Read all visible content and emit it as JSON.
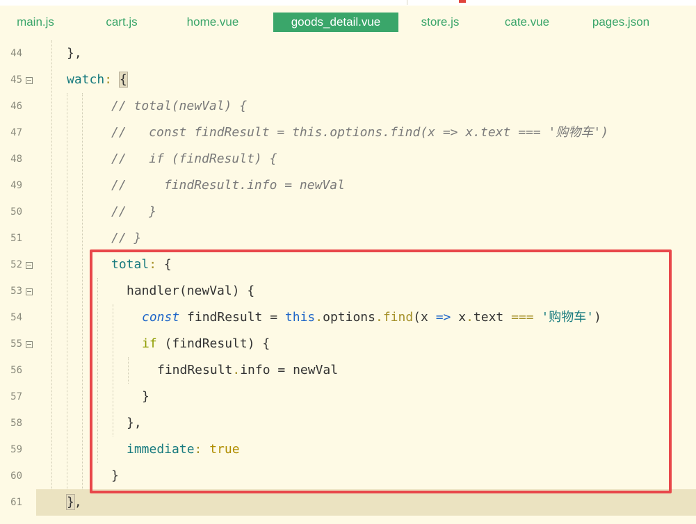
{
  "tabs": [
    {
      "label": "main.js",
      "active": false
    },
    {
      "label": "cart.js",
      "active": false
    },
    {
      "label": "home.vue",
      "active": false
    },
    {
      "label": "goods_detail.vue",
      "active": true
    },
    {
      "label": "store.js",
      "active": false
    },
    {
      "label": "cate.vue",
      "active": false
    },
    {
      "label": "pages.json",
      "active": false
    }
  ],
  "colors": {
    "background": "#fefae5",
    "tab_text": "#3aa56a",
    "active_tab_bg": "#3aa66a",
    "highlight_box": "#e8474a",
    "current_line": "#ebe3c1"
  },
  "editor": {
    "lines": [
      {
        "n": "44",
        "fold": false,
        "tokens": [
          {
            "t": "},",
            "c": ""
          }
        ]
      },
      {
        "n": "45",
        "fold": true,
        "tokens": [
          {
            "t": "watch",
            "c": "key"
          },
          {
            "t": ": ",
            "c": "punc"
          },
          {
            "t": "{",
            "c": "bracehl"
          }
        ]
      },
      {
        "n": "46",
        "fold": false,
        "tokens": [
          {
            "t": "// total(newVal) {",
            "c": "cmt"
          }
        ]
      },
      {
        "n": "47",
        "fold": false,
        "tokens": [
          {
            "t": "//   const findResult = this.options.find(x => x.text === '购物车')",
            "c": "cmt"
          }
        ]
      },
      {
        "n": "48",
        "fold": false,
        "tokens": [
          {
            "t": "//   if (findResult) {",
            "c": "cmt"
          }
        ]
      },
      {
        "n": "49",
        "fold": false,
        "tokens": [
          {
            "t": "//     findResult.info = newVal",
            "c": "cmt"
          }
        ]
      },
      {
        "n": "50",
        "fold": false,
        "tokens": [
          {
            "t": "//   }",
            "c": "cmt"
          }
        ]
      },
      {
        "n": "51",
        "fold": false,
        "tokens": [
          {
            "t": "// }",
            "c": "cmt"
          }
        ]
      },
      {
        "n": "52",
        "fold": true,
        "tokens": [
          {
            "t": "total",
            "c": "key"
          },
          {
            "t": ": ",
            "c": "punc"
          },
          {
            "t": "{",
            "c": ""
          }
        ]
      },
      {
        "n": "53",
        "fold": true,
        "tokens": [
          {
            "t": "handler(newVal) {",
            "c": ""
          }
        ]
      },
      {
        "n": "54",
        "fold": false,
        "tokens": [
          {
            "t": "const",
            "c": "kw"
          },
          {
            "t": " findResult = ",
            "c": ""
          },
          {
            "t": "this",
            "c": "this"
          },
          {
            "t": ".",
            "c": "punc"
          },
          {
            "t": "options",
            "c": ""
          },
          {
            "t": ".",
            "c": "punc"
          },
          {
            "t": "find",
            "c": "fn"
          },
          {
            "t": "(x ",
            "c": ""
          },
          {
            "t": "=>",
            "c": "arrow"
          },
          {
            "t": " x",
            "c": ""
          },
          {
            "t": ".",
            "c": "punc"
          },
          {
            "t": "text ",
            "c": ""
          },
          {
            "t": "===",
            "c": "punc"
          },
          {
            "t": " ",
            "c": ""
          },
          {
            "t": "'购物车'",
            "c": "str"
          },
          {
            "t": ")",
            "c": ""
          }
        ]
      },
      {
        "n": "55",
        "fold": true,
        "tokens": [
          {
            "t": "if",
            "c": "if"
          },
          {
            "t": " (findResult) {",
            "c": ""
          }
        ]
      },
      {
        "n": "56",
        "fold": false,
        "tokens": [
          {
            "t": "findResult",
            "c": ""
          },
          {
            "t": ".",
            "c": "punc"
          },
          {
            "t": "info = newVal",
            "c": ""
          }
        ]
      },
      {
        "n": "57",
        "fold": false,
        "tokens": [
          {
            "t": "}",
            "c": ""
          }
        ]
      },
      {
        "n": "58",
        "fold": false,
        "tokens": [
          {
            "t": "},",
            "c": ""
          }
        ]
      },
      {
        "n": "59",
        "fold": false,
        "tokens": [
          {
            "t": "immediate",
            "c": "key"
          },
          {
            "t": ": ",
            "c": "punc"
          },
          {
            "t": "true",
            "c": "bool"
          }
        ]
      },
      {
        "n": "60",
        "fold": false,
        "tokens": [
          {
            "t": "}",
            "c": ""
          }
        ]
      },
      {
        "n": "61",
        "fold": false,
        "tokens": [
          {
            "t": "}",
            "c": "bracehl"
          },
          {
            "t": ",",
            "c": ""
          }
        ]
      }
    ]
  }
}
